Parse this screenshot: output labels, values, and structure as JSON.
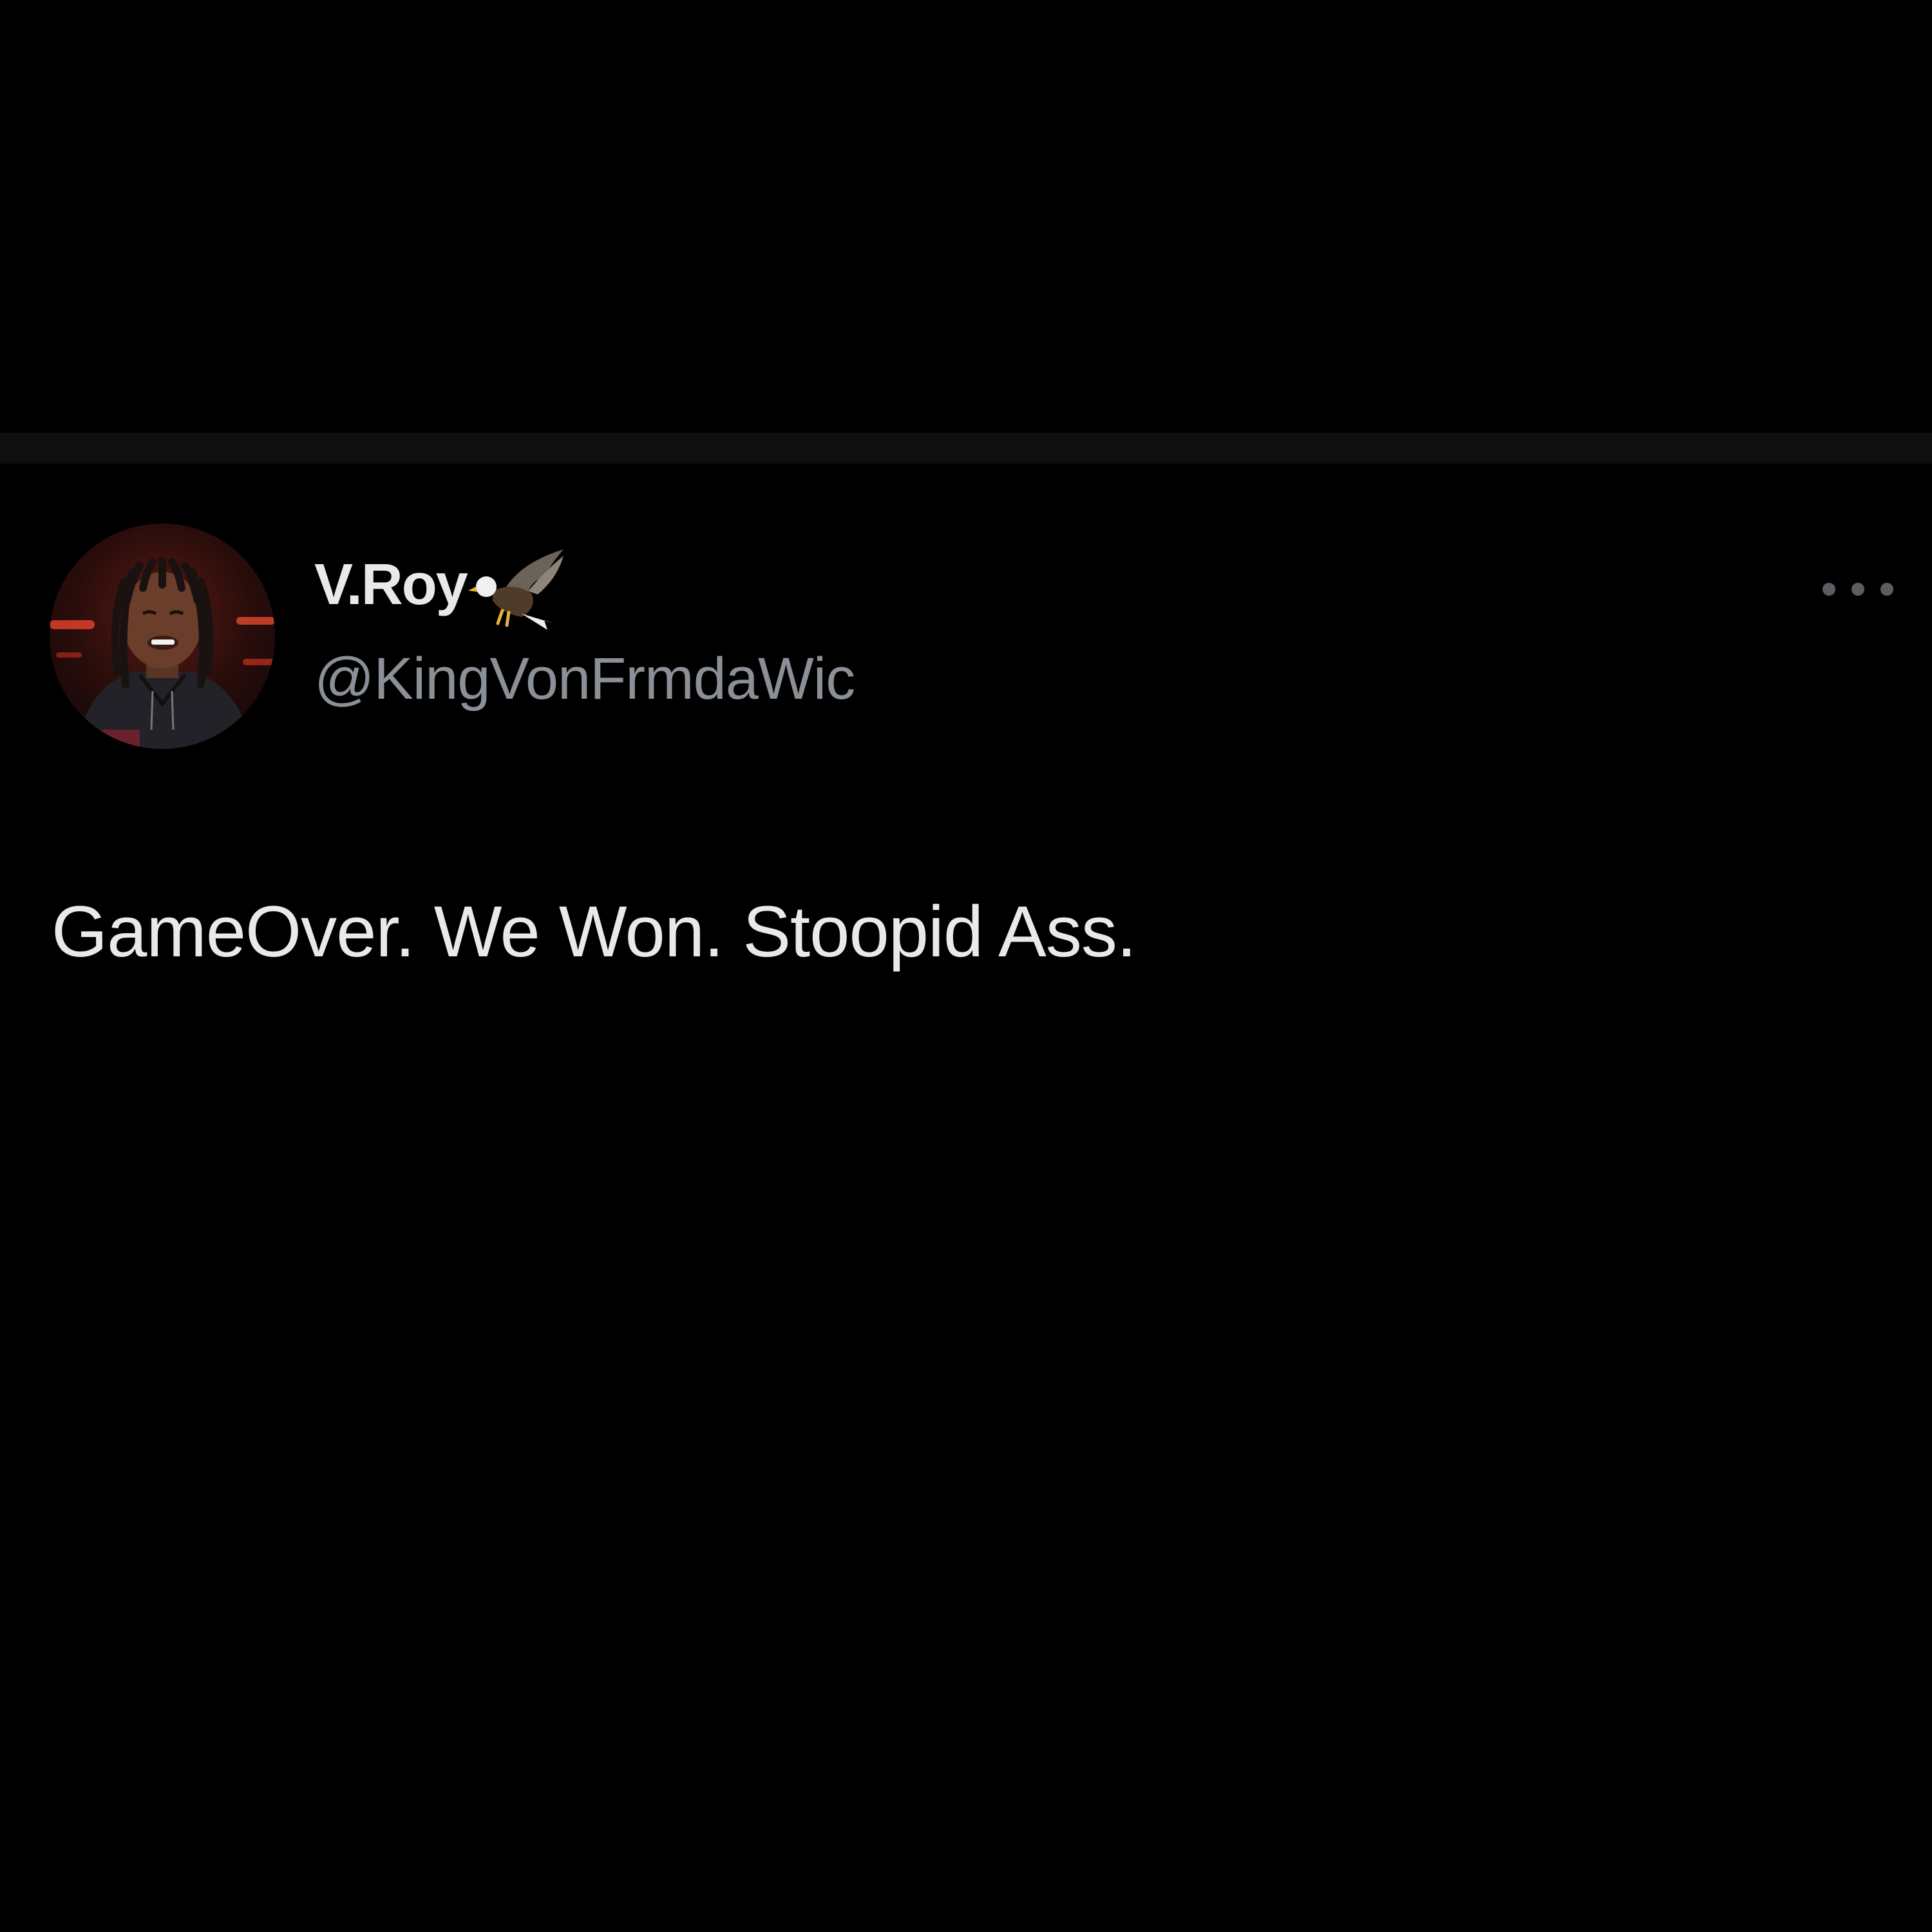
{
  "tweet": {
    "author": {
      "display_name": "V.Roy",
      "display_name_icon": "eagle-icon",
      "handle": "@KingVonFrmdaWic",
      "avatar": "profile-photo"
    },
    "text": "GameOver. We Won. Stoopid Ass.",
    "menu_icon": "more-options-icon"
  },
  "colors": {
    "background": "#000000",
    "primary_text": "#e7e9ea",
    "secondary_text": "#8b9096",
    "divider": "#0f0f0f"
  }
}
